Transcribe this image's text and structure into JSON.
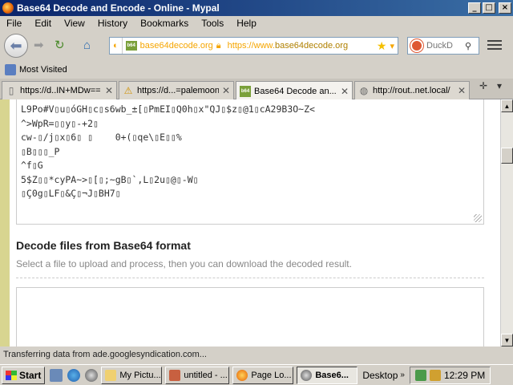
{
  "window": {
    "title": "Base64 Decode and Encode - Online - Mypal",
    "minimize": "_",
    "maximize": "□",
    "close": "×"
  },
  "menu": [
    "File",
    "Edit",
    "View",
    "History",
    "Bookmarks",
    "Tools",
    "Help"
  ],
  "nav": {
    "identity_site": "base64decode.org",
    "url_prefix": "https://www.",
    "url_domain": "base64decode.org",
    "search_placeholder": "DuckD"
  },
  "bookmarks": {
    "most_visited": "Most Visited"
  },
  "tabs": [
    {
      "label": "https://d..IN+MDw==",
      "active": false
    },
    {
      "label": "https://d...=palemoon",
      "active": false
    },
    {
      "label": "Base64 Decode an...",
      "active": true
    },
    {
      "label": "http://rout..net.local/",
      "active": false
    }
  ],
  "decoded_lines": [
    "L9Po#V▯u▯óGH▯c▯s6wb_±[▯PmEI▯Q0h▯x\"QJ▯$z▯@1▯cA29B3O~Z<",
    "^>WpR=▯▯y▯-+2▯",
    "cw-▯/j▯x▯6▯ ▯    0+(▯qe\\▯E▯▯%",
    "▯B▯▯▯_P",
    "^f▯G",
    "5$Z▯▯*cyPA~>▯[▯;~gB▯`,L▯2u▯@▯-W▯",
    "▯Ç0g▯LF▯&Ç▯¬J▯BH7▯"
  ],
  "decode_files": {
    "heading": "Decode files from Base64 format",
    "description": "Select a file to upload and process, then you can download the decoded result."
  },
  "status": "Transferring data from ade.googlesyndication.com...",
  "taskbar": {
    "start": "Start",
    "items": [
      {
        "label": "My Pictu...",
        "active": false
      },
      {
        "label": "untitled - ...",
        "active": false
      },
      {
        "label": "Page Lo...",
        "active": false
      },
      {
        "label": "Base6...",
        "active": true
      }
    ],
    "desktop": "Desktop",
    "clock": "12:29 PM"
  }
}
